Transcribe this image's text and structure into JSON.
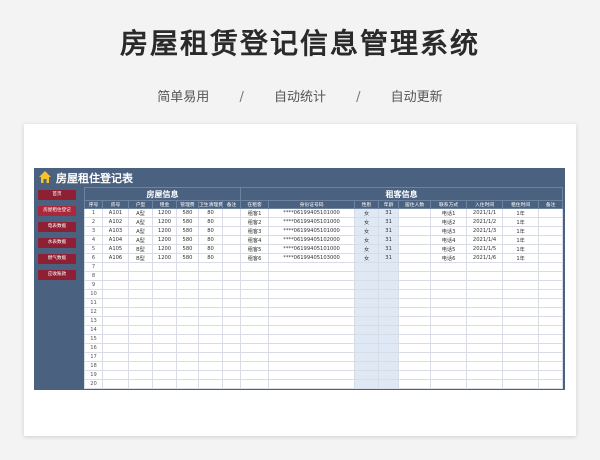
{
  "page": {
    "title": "房屋租赁登记信息管理系统",
    "features": [
      "简单易用",
      "自动统计",
      "自动更新"
    ],
    "separator": "/"
  },
  "sheet": {
    "title": "房屋租住登记表",
    "sidebar": [
      {
        "label": "首页",
        "active": false
      },
      {
        "label": "房屋租住登记",
        "active": true
      },
      {
        "label": "电表数据",
        "active": false
      },
      {
        "label": "水表数据",
        "active": false
      },
      {
        "label": "燃气数据",
        "active": false
      },
      {
        "label": "应收账款",
        "active": false
      }
    ],
    "groups": {
      "house": "房屋信息",
      "tenant": "租客信息"
    },
    "columns": [
      "序号",
      "房号",
      "户型",
      "租金",
      "管理费",
      "卫生清理费",
      "备注",
      "在租客",
      "身份证号码",
      "性别",
      "年龄",
      "居住人数",
      "联系方式",
      "入住时间",
      "租住时间",
      "备注"
    ],
    "rows": [
      [
        "1",
        "A101",
        "A型",
        "1200",
        "580",
        "80",
        "",
        "租客1",
        "****06199405101000",
        "女",
        "31",
        "",
        "电话1",
        "2021/1/1",
        "1年",
        ""
      ],
      [
        "2",
        "A102",
        "A型",
        "1200",
        "580",
        "80",
        "",
        "租客2",
        "****06199405101000",
        "女",
        "31",
        "",
        "电话2",
        "2021/1/2",
        "1年",
        ""
      ],
      [
        "3",
        "A103",
        "A型",
        "1200",
        "580",
        "80",
        "",
        "租客3",
        "****06199405101000",
        "女",
        "31",
        "",
        "电话3",
        "2021/1/3",
        "1年",
        ""
      ],
      [
        "4",
        "A104",
        "A型",
        "1200",
        "580",
        "80",
        "",
        "租客4",
        "****06199405102000",
        "女",
        "31",
        "",
        "电话4",
        "2021/1/4",
        "1年",
        ""
      ],
      [
        "5",
        "A105",
        "B型",
        "1200",
        "580",
        "80",
        "",
        "租客5",
        "****06199405101000",
        "女",
        "31",
        "",
        "电话5",
        "2021/1/5",
        "1年",
        ""
      ],
      [
        "6",
        "A106",
        "B型",
        "1200",
        "580",
        "80",
        "",
        "租客6",
        "****06199405103000",
        "女",
        "31",
        "",
        "电话6",
        "2021/1/6",
        "1年",
        ""
      ],
      [
        "7"
      ],
      [
        "8"
      ],
      [
        "9"
      ],
      [
        "10"
      ],
      [
        "11"
      ],
      [
        "12"
      ],
      [
        "13"
      ],
      [
        "14"
      ],
      [
        "15"
      ],
      [
        "16"
      ],
      [
        "17"
      ],
      [
        "18"
      ],
      [
        "19"
      ],
      [
        "20"
      ]
    ]
  },
  "colors": {
    "header": "#4a6180",
    "button": "#8f1f32",
    "highlight": "#dfe9f5"
  }
}
